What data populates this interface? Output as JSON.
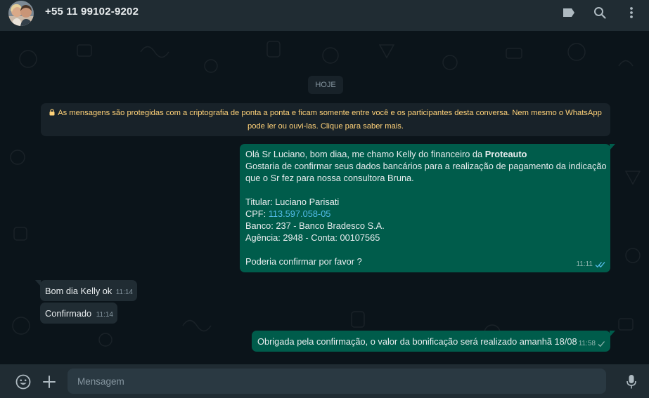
{
  "header": {
    "contact_name": "+55 11 99102-9202",
    "icons": [
      "label-icon",
      "search-icon",
      "menu-icon"
    ]
  },
  "chat": {
    "date_chip": "HOJE",
    "encryption_notice": {
      "line1": "As mensagens são protegidas com a criptografia de ponta a ponta e ficam somente entre você e os participantes desta conversa. Nem mesmo o WhatsApp",
      "line2": "pode ler ou ouvi-las. Clique para saber mais."
    },
    "messages": [
      {
        "direction": "out",
        "lines": {
          "greeting_prefix": "Olá Sr Luciano, bom diaa, me chamo Kelly do financeiro da ",
          "company": "Proteauto",
          "l2": "Gostaria de confirmar seus dados bancários para a realização de pagamento da indicação",
          "l3": "que o Sr fez para nossa consultora Bruna.",
          "holder": "Titular: Luciano Parisati",
          "cpf_label": "CPF: ",
          "cpf_value": "113.597.058-05",
          "bank": "Banco: 237 - Banco Bradesco S.A.",
          "agency": "Agência: 2948 - Conta: 00107565",
          "closing": "Poderia confirmar por favor ?"
        },
        "time": "11:11",
        "status": "read"
      },
      {
        "direction": "in",
        "text": "Bom dia Kelly ok",
        "time": "11:14"
      },
      {
        "direction": "in",
        "text": "Confirmado",
        "time": "11:14"
      },
      {
        "direction": "out",
        "text": "Obrigada pela confirmação, o valor da bonificação será realizado amanhã 18/08",
        "time": "11:58",
        "status": "sent"
      }
    ]
  },
  "composer": {
    "placeholder": "Mensagem",
    "icons": [
      "emoji-icon",
      "attach-icon",
      "microphone-icon"
    ]
  },
  "colors": {
    "header_bg": "#202c33",
    "chat_bg": "#0b141a",
    "outgoing_bubble": "#005c4b",
    "incoming_bubble": "#202c33",
    "link": "#53bdeb",
    "notice_text": "#ffd279",
    "icon": "#aebac1"
  }
}
